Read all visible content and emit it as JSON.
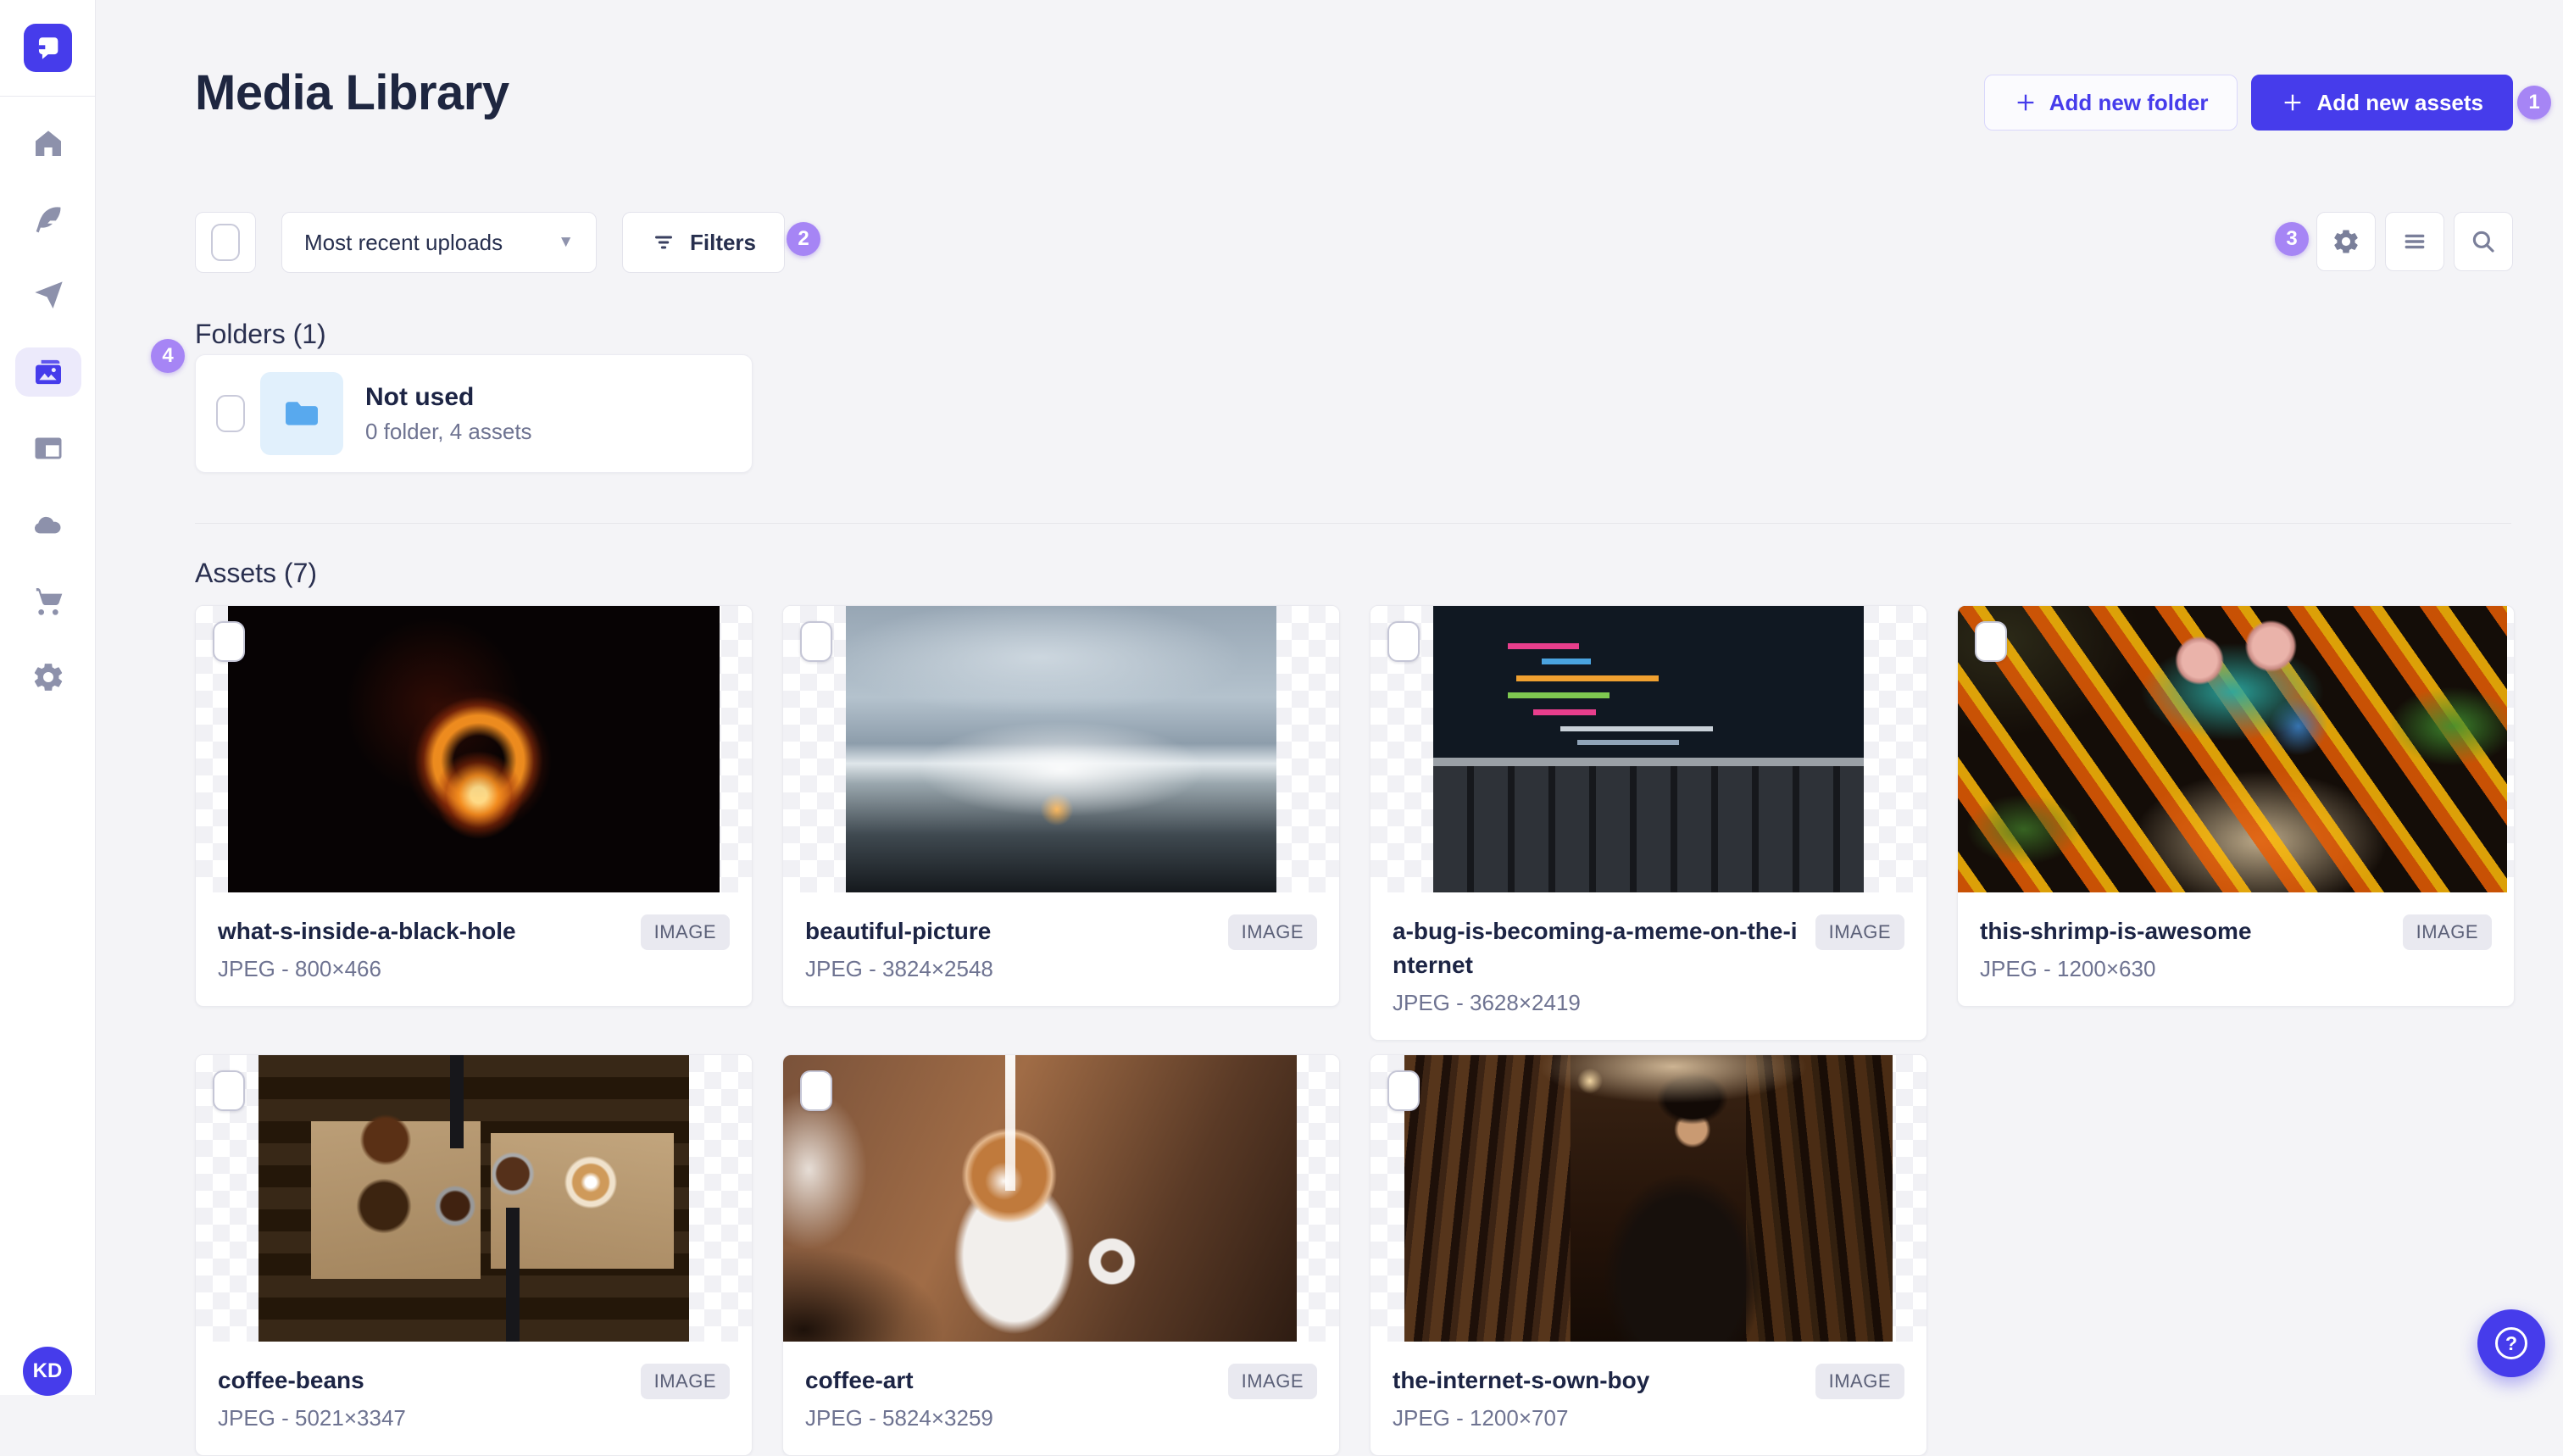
{
  "colors": {
    "accent": "#463ceb",
    "annotation_badge": "#a685f5",
    "active_nav_bg": "#eceafb"
  },
  "sidebar": {
    "avatar_initials": "KD",
    "nav_items": [
      {
        "icon": "home"
      },
      {
        "icon": "feather"
      },
      {
        "icon": "paper-plane"
      },
      {
        "icon": "images",
        "active": true
      },
      {
        "icon": "layout"
      },
      {
        "icon": "cloud"
      },
      {
        "icon": "cart"
      },
      {
        "icon": "gear"
      }
    ]
  },
  "header": {
    "title": "Media Library",
    "add_folder_label": "Add new folder",
    "add_assets_label": "Add new assets"
  },
  "toolbar": {
    "sort_selected": "Most recent uploads",
    "filters_label": "Filters"
  },
  "annotations": [
    "1",
    "2",
    "3",
    "4"
  ],
  "folders": {
    "heading": "Folders (1)",
    "items": [
      {
        "name": "Not used",
        "meta": "0 folder, 4 assets"
      }
    ]
  },
  "assets": {
    "heading": "Assets (7)",
    "type_badge": "IMAGE",
    "items": [
      {
        "name": "what-s-inside-a-black-hole",
        "meta": "JPEG - 800×466"
      },
      {
        "name": "beautiful-picture",
        "meta": "JPEG - 3824×2548"
      },
      {
        "name": "a-bug-is-becoming-a-meme-on-the-internet",
        "meta": "JPEG - 3628×2419"
      },
      {
        "name": "this-shrimp-is-awesome",
        "meta": "JPEG - 1200×630"
      },
      {
        "name": "coffee-beans",
        "meta": "JPEG - 5021×3347"
      },
      {
        "name": "coffee-art",
        "meta": "JPEG - 5824×3259"
      },
      {
        "name": "the-internet-s-own-boy",
        "meta": "JPEG - 1200×707"
      }
    ]
  }
}
